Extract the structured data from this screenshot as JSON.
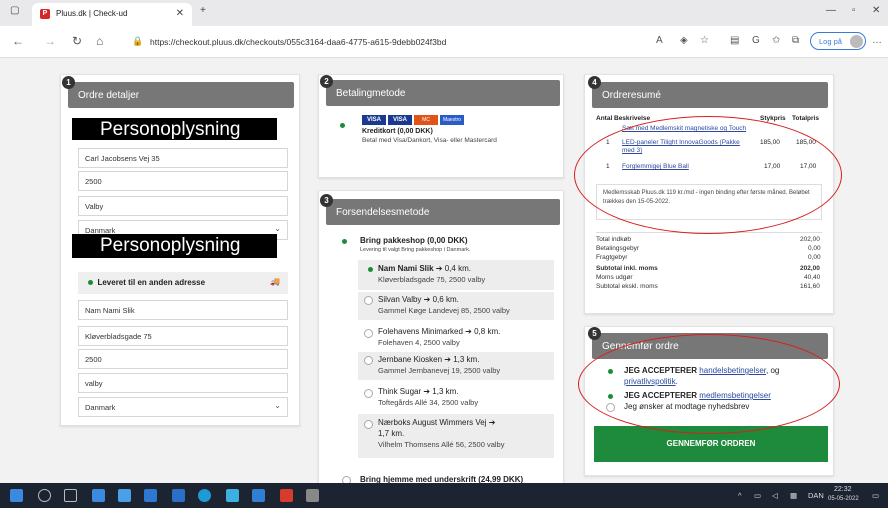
{
  "browser": {
    "tab_title": "Pluus.dk | Check-ud",
    "url": "https://checkout.pluus.dk/checkouts/055c3164-daa6-4775-a615-9debb024f3bd",
    "login_label": "Log på"
  },
  "sec1": {
    "num": "1",
    "title": "Ordre detaljer",
    "redact": "Personoplysning",
    "addr": "Carl Jacobsens Vej 35",
    "zip": "2500",
    "city": "Valby",
    "country": "Danmark",
    "redact2": "Personoplysning",
    "alt_delivery": "Leveret til en anden adresse",
    "name2": "Nam Nami Slik",
    "addr2": "Kløverbladsgade 75",
    "zip2": "2500",
    "city2": "valby",
    "country2": "Danmark"
  },
  "sec2": {
    "num": "2",
    "title": "Betalingmetode",
    "card_label": "Kreditkort (0,00 DKK)",
    "card_sub": "Betal med Visa/Dankort, Visa- eller Mastercard",
    "logos": [
      "VISA",
      "VISA",
      "MC",
      "Maestro"
    ]
  },
  "sec3": {
    "num": "3",
    "title": "Forsendelsesmetode",
    "main": "Bring pakkeshop (0,00 DKK)",
    "main_sub": "Levering til valgt Bring pakkeshop i Danmark.",
    "options": [
      {
        "name": "Nam Nami Slik",
        "dist": "0,4 km.",
        "addr": "Kløverbladsgade 75, 2500 valby"
      },
      {
        "name": "Silvan Valby",
        "dist": "0,6 km.",
        "addr": "Gammel Køge Landevej 85, 2500 valby"
      },
      {
        "name": "Folehavens Minimarked",
        "dist": "0,8 km.",
        "addr": "Folehaven 4, 2500 valby"
      },
      {
        "name": "Jernbane Kiosken",
        "dist": "1,3 km.",
        "addr": "Gammel Jernbanevej 19, 2500 valby"
      },
      {
        "name": "Think Sugar",
        "dist": "1,3 km.",
        "addr": "Toftegårds Allé 34, 2500 valby"
      },
      {
        "name": "Nærboks August Wimmers Vej",
        "dist": "1,7 km.",
        "addr": "Vilhelm Thomsens Allé 56, 2500 valby"
      }
    ],
    "last": "Bring hjemme med underskrift (24,99 DKK)"
  },
  "sec4": {
    "num": "4",
    "title": "Ordreresumé",
    "cols": [
      "Antal",
      "Beskrivelse",
      "Stykpris",
      "Totalpris"
    ],
    "items": [
      {
        "qty": "",
        "desc": "Sæt med Medlemskit magnetiske og Touch",
        "unit": "",
        "total": ""
      },
      {
        "qty": "1",
        "desc": "LED-paneler Tilight InnovaGoods (Pakke med 3)",
        "unit": "185,00",
        "total": "185,00"
      },
      {
        "qty": "1",
        "desc": "Forglemmigej Blue Ball",
        "unit": "17,00",
        "total": "17,00"
      }
    ],
    "note": "Medlemsskab Pluus.dk 119 kr./md - ingen binding efter første måned. Beløbet trækkes den 15-05-2022.",
    "totals": [
      {
        "label": "Total indkøb",
        "value": "202,00"
      },
      {
        "label": "Betalingsgebyr",
        "value": "0,00"
      },
      {
        "label": "Fragtgebyr",
        "value": "0,00"
      },
      {
        "label": "Subtotal inkl. moms",
        "value": "202,00"
      },
      {
        "label": "Moms udgør",
        "value": "40,40"
      },
      {
        "label": "Subtotal ekskl. moms",
        "value": "161,60"
      }
    ]
  },
  "sec5": {
    "num": "5",
    "title": "Gennemfør ordre",
    "accept1": "JEG ACCEPTERER",
    "accept1_link": "handelsbetingelser",
    "accept1_tail": ", og",
    "accept1_link2": "privatlivspolitik",
    "accept1_end": ".",
    "accept2": "JEG ACCEPTERER",
    "accept2_link": "medlemsbetingelser",
    "newsletter": "Jeg ønsker at modtage nyhedsbrev",
    "button": "GENNEMFØR ORDREN"
  },
  "taskbar": {
    "lang": "DAN",
    "time": "22:32",
    "date": "05-05-2022"
  }
}
